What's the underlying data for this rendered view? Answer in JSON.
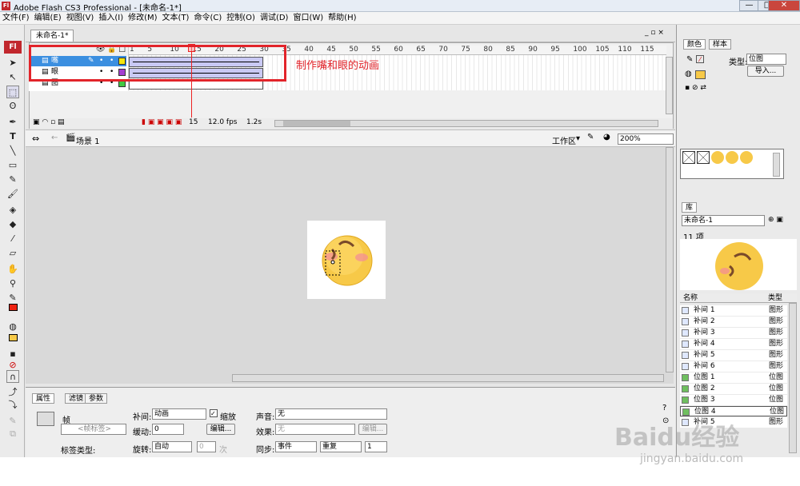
{
  "window": {
    "title": "Adobe Flash CS3 Professional - [未命名-1*]",
    "logo": "Fl",
    "minimize": "—",
    "maximize": "□",
    "close": "✕"
  },
  "menu": [
    "文件(F)",
    "编辑(E)",
    "视图(V)",
    "插入(I)",
    "修改(M)",
    "文本(T)",
    "命令(C)",
    "控制(O)",
    "调试(D)",
    "窗口(W)",
    "帮助(H)"
  ],
  "document": {
    "tab": "未命名-1*",
    "scene": "场景 1",
    "workspace": "工作区",
    "zoom": "200%"
  },
  "timeline": {
    "ruler": [
      "1",
      "5",
      "10",
      "15",
      "20",
      "25",
      "30",
      "35",
      "40",
      "45",
      "50",
      "55",
      "60",
      "65",
      "70",
      "75",
      "80",
      "85",
      "90",
      "95",
      "100",
      "105",
      "110",
      "115"
    ],
    "layers": [
      {
        "name": "嘴",
        "selected": true,
        "color": "#f3e60e"
      },
      {
        "name": "眼",
        "selected": false,
        "color": "#a43fd1"
      },
      {
        "name": "图",
        "selected": false,
        "color": "#42c842"
      }
    ],
    "annotation": "制作嘴和眼的动画",
    "current_frame": "15",
    "fps": "12.0 fps",
    "time": "1.2s"
  },
  "properties": {
    "tabs": [
      "属性",
      "滤镜",
      "参数"
    ],
    "frame_label": "帧",
    "frame_label_placeholder": "<帧标签>",
    "label_type": "标签类型:",
    "tween_label": "补间:",
    "tween_value": "动画",
    "scale_label": "缩放",
    "ease_label": "缓动:",
    "ease_value": "0",
    "edit_button": "编辑...",
    "rotate_label": "旋转:",
    "rotate_value": "自动",
    "rotate_count": "0",
    "times_label": "次",
    "sound_label": "声音:",
    "sound_value": "无",
    "effect_label": "效果:",
    "effect_value": "无",
    "edit2": "编辑...",
    "sync_label": "同步:",
    "sync_value": "事件",
    "repeat_value": "重复",
    "repeat_count": "1"
  },
  "color_panel": {
    "tabs": [
      "颜色",
      "样本"
    ],
    "type_label": "类型:",
    "type_value": "位图",
    "import_button": "导入..."
  },
  "library": {
    "tab": "库",
    "doc": "未命名-1",
    "count": "11 项",
    "col_name": "名称",
    "col_type": "类型",
    "items": [
      {
        "name": "补间 1",
        "type": "图形"
      },
      {
        "name": "补间 2",
        "type": "图形"
      },
      {
        "name": "补间 3",
        "type": "图形"
      },
      {
        "name": "补间 4",
        "type": "图形"
      },
      {
        "name": "补间 5",
        "type": "图形"
      },
      {
        "name": "补间 6",
        "type": "图形"
      },
      {
        "name": "位图 1",
        "type": "位图"
      },
      {
        "name": "位图 2",
        "type": "位图"
      },
      {
        "name": "位图 3",
        "type": "位图"
      },
      {
        "name": "位图 4",
        "type": "位图"
      },
      {
        "name": "补间 5",
        "type": "图形"
      }
    ]
  },
  "watermark": {
    "brand": "Baidu经验",
    "url": "jingyan.baidu.com"
  }
}
